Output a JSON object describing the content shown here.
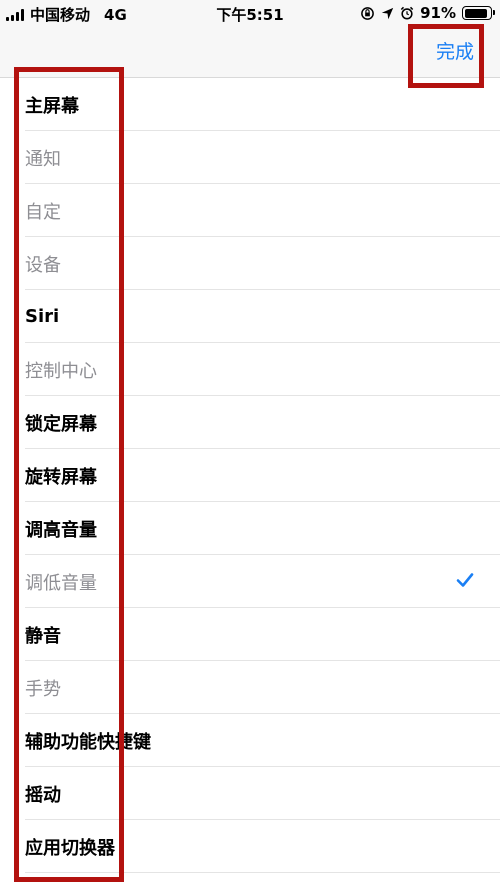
{
  "status_bar": {
    "carrier": "中国移动",
    "network": "4G",
    "time": "下午5:51",
    "battery_percent": "91%",
    "battery_level": 0.91
  },
  "nav": {
    "done_label": "完成"
  },
  "list": {
    "items": [
      {
        "label": "主屏幕",
        "enabled": true
      },
      {
        "label": "通知",
        "enabled": false
      },
      {
        "label": "自定",
        "enabled": false
      },
      {
        "label": "设备",
        "enabled": false
      },
      {
        "label": "Siri",
        "enabled": true
      },
      {
        "label": "控制中心",
        "enabled": false
      },
      {
        "label": "锁定屏幕",
        "enabled": true
      },
      {
        "label": "旋转屏幕",
        "enabled": true
      },
      {
        "label": "调高音量",
        "enabled": true
      },
      {
        "label": "调低音量",
        "enabled": false,
        "checked": true
      },
      {
        "label": "静音",
        "enabled": true
      },
      {
        "label": "手势",
        "enabled": false
      },
      {
        "label": "辅助功能快捷键",
        "enabled": true
      },
      {
        "label": "摇动",
        "enabled": true
      },
      {
        "label": "应用切换器",
        "enabled": true
      }
    ]
  },
  "colors": {
    "accent": "#1a7ff4",
    "annotation": "#b3120f",
    "dim_text": "#8e8e93"
  },
  "icons": {
    "signal": "signal-bars-icon",
    "orientation_lock": "orientation-lock-icon",
    "location": "location-arrow-icon",
    "alarm": "alarm-clock-icon",
    "battery": "battery-icon",
    "checkmark": "checkmark-icon"
  }
}
